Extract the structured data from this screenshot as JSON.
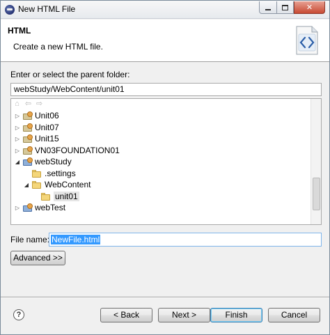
{
  "window": {
    "title": "New HTML File"
  },
  "header": {
    "title": "HTML",
    "description": "Create a new HTML file."
  },
  "folder": {
    "label": "Enter or select the parent folder:",
    "value": "webStudy/WebContent/unit01"
  },
  "tree": {
    "items": [
      {
        "label": "Unit06",
        "expanded": false
      },
      {
        "label": "Unit07",
        "expanded": false
      },
      {
        "label": "Unit15",
        "expanded": false
      },
      {
        "label": "VN03FOUNDATION01",
        "expanded": false
      },
      {
        "label": "webStudy",
        "expanded": true
      },
      {
        "label": ".settings"
      },
      {
        "label": "WebContent",
        "expanded": true
      },
      {
        "label": "unit01",
        "selected": true
      },
      {
        "label": "webTest",
        "expanded": false
      }
    ]
  },
  "file_name": {
    "label": "File name:",
    "value": "NewFile.html"
  },
  "buttons": {
    "advanced": "Advanced >>",
    "back": "< Back",
    "next": "Next >",
    "finish": "Finish",
    "cancel": "Cancel"
  },
  "window_controls": {
    "close": "✕"
  },
  "colors": {
    "selection": "#3399ff",
    "default_button_border": "#3c7fb1"
  }
}
